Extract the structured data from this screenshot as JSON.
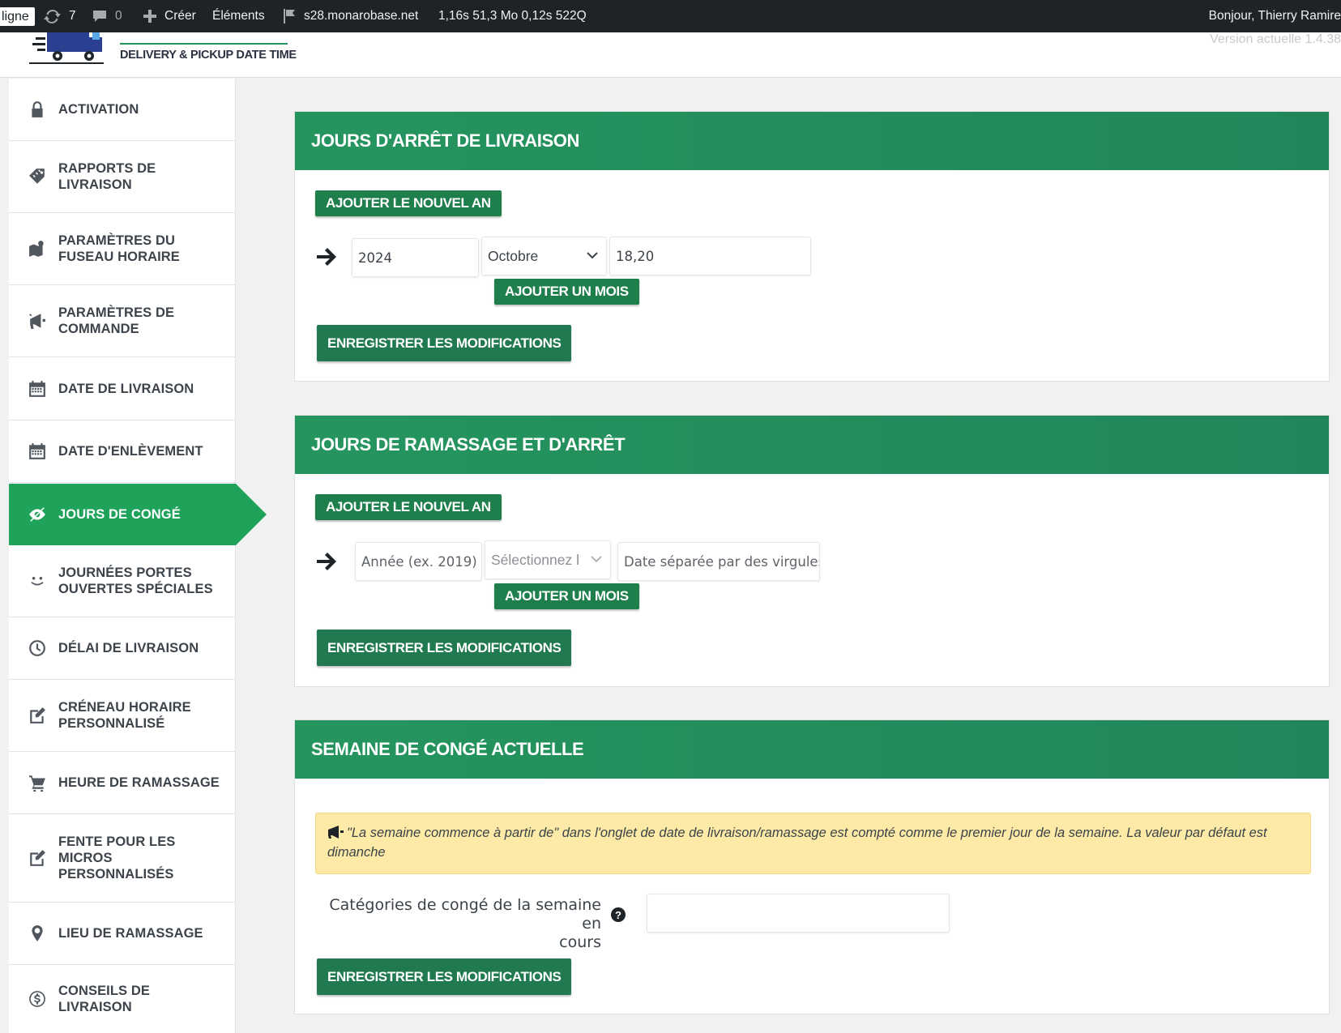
{
  "admin_bar": {
    "ligne": "ligne",
    "updates_count": "7",
    "comments_count": "0",
    "create_label": "Créer",
    "elements_label": "Éléments",
    "site_name": "s28.monarobase.net",
    "perf_stats": "1,16s  51,3 Mo  0,12s  522Q",
    "greeting": "Bonjour, Thierry Ramire"
  },
  "plugin": {
    "title": "DELIVERY & PICKUP DATE TIME",
    "version": "Version actuelle 1.4.38",
    "brand_color": "#1fa35b"
  },
  "sidebar": {
    "items": [
      {
        "label": "Activation",
        "icon": "lock-icon"
      },
      {
        "label": "Rapports de livraison",
        "icon": "tag-icon"
      },
      {
        "label": "Paramètres du fuseau horaire",
        "icon": "map-marker-icon"
      },
      {
        "label": "Paramètres de commande",
        "icon": "megaphone-icon"
      },
      {
        "label": "Date de livraison",
        "icon": "calendar-icon"
      },
      {
        "label": "Date d'enlèvement",
        "icon": "calendar-icon"
      },
      {
        "label": "Jours de congé",
        "icon": "hidden-eye-icon",
        "active": true
      },
      {
        "label": "Journées portes ouvertes spéciales",
        "icon": "smiley-icon"
      },
      {
        "label": "Délai de livraison",
        "icon": "clock-icon"
      },
      {
        "label": "Créneau horaire personnalisé",
        "icon": "edit-icon"
      },
      {
        "label": "Heure de ramassage",
        "icon": "cart-icon"
      },
      {
        "label": "Fente pour les micros personnalisés",
        "icon": "edit-icon"
      },
      {
        "label": "Lieu de ramassage",
        "icon": "location-pin-icon"
      },
      {
        "label": "Conseils de livraison",
        "icon": "dollar-circle-icon"
      }
    ]
  },
  "sections": {
    "delivery_off": {
      "title": "Jours d'arrêt de livraison",
      "add_year_label": "AJOUTER LE NOUVEL AN",
      "year_value": "2024",
      "month_value": "Octobre",
      "dates_value": "18,20",
      "add_month_label": "AJOUTER UN MOIS",
      "save_label": "ENREGISTRER LES MODIFICATIONS"
    },
    "pickup_off": {
      "title": "Jours de ramassage et d'arrêt",
      "add_year_label": "AJOUTER LE NOUVEL AN",
      "year_placeholder": "Année (ex. 2019)",
      "month_placeholder": "Sélectionnez l",
      "dates_placeholder": "Date séparée par des virgules",
      "add_month_label": "AJOUTER UN MOIS",
      "save_label": "ENREGISTRER LES MODIFICATIONS"
    },
    "week_off": {
      "title": "Semaine de congé actuelle",
      "notice": "\"La semaine commence à partir de\" dans l'onglet de date de livraison/ramassage est compté comme le premier jour de la semaine. La valeur par défaut est dimanche",
      "categories_label_line1": "Catégories de congé de la semaine en",
      "categories_label_line2": "cours",
      "categories_value": "",
      "save_label": "ENREGISTRER LES MODIFICATIONS"
    }
  }
}
